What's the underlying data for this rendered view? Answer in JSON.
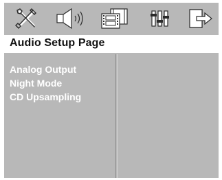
{
  "icons": [
    {
      "name": "general-setup-icon"
    },
    {
      "name": "audio-setup-icon"
    },
    {
      "name": "video-setup-icon"
    },
    {
      "name": "preference-setup-icon"
    },
    {
      "name": "exit-icon"
    }
  ],
  "page": {
    "title": "Audio Setup Page"
  },
  "menu": {
    "items": [
      {
        "label": "Analog Output"
      },
      {
        "label": "Night Mode"
      },
      {
        "label": "CD Upsampling"
      }
    ]
  },
  "colors": {
    "background": "#b8b8b8",
    "title_bar": "#ffffff",
    "menu_text": "#ffffff"
  }
}
